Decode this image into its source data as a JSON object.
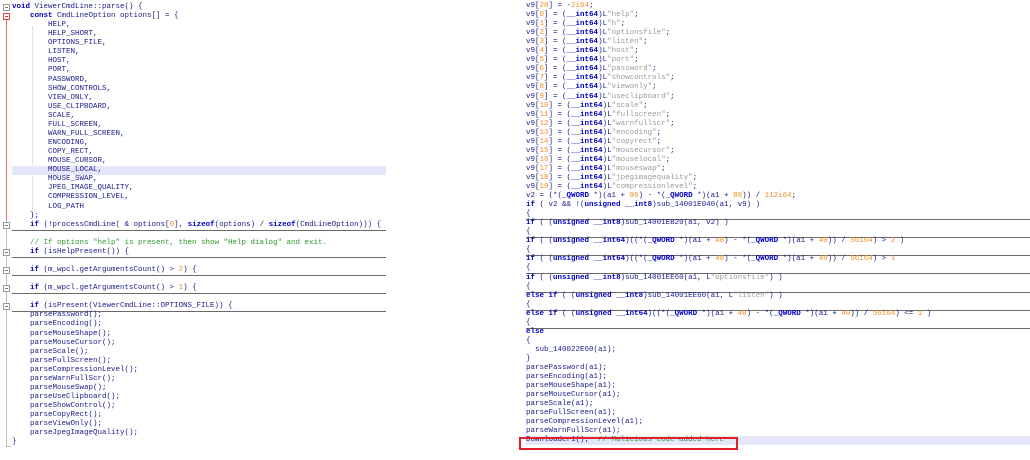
{
  "left_code": {
    "highlight_index": 18,
    "lines": [
      {
        "text": "void ViewerCmdLine::parse() {",
        "fold": "open"
      },
      {
        "text": "    const CmdLineOption options[] = {",
        "fold": "red"
      },
      {
        "text": "        HELP,"
      },
      {
        "text": "        HELP_SHORT,"
      },
      {
        "text": "        OPTIONS_FILE,"
      },
      {
        "text": "        LISTEN,"
      },
      {
        "text": "        HOST,"
      },
      {
        "text": "        PORT,"
      },
      {
        "text": "        PASSWORD,"
      },
      {
        "text": "        SHOW_CONTROLS,"
      },
      {
        "text": "        VIEW_ONLY,"
      },
      {
        "text": "        USE_CLIPBOARD,"
      },
      {
        "text": "        SCALE,"
      },
      {
        "text": "        FULL_SCREEN,"
      },
      {
        "text": "        WARN_FULL_SCREEN,"
      },
      {
        "text": "        ENCODING,"
      },
      {
        "text": "        COPY_RECT,"
      },
      {
        "text": "        MOUSE_CURSOR,"
      },
      {
        "text": "        MOUSE_LOCAL,"
      },
      {
        "text": "        MOUSE_SWAP,"
      },
      {
        "text": "        JPEG_IMAGE_QUALITY,"
      },
      {
        "text": "        COMPRESSION_LEVEL,"
      },
      {
        "text": "        LOG_PATH"
      },
      {
        "text": "    };"
      },
      {
        "text": "    if (!processCmdLine( & options[0], sizeof(options) / sizeof(CmdLineOption))) {",
        "fold": "closed",
        "collapsed": true
      },
      {
        "text": ""
      },
      {
        "text": "    // If options \"help\" is present, then show \"Help dialog\" and exit."
      },
      {
        "text": "    if (isHelpPresent()) {",
        "fold": "closed",
        "collapsed": true
      },
      {
        "text": ""
      },
      {
        "text": "    if (m_wpcl.getArgumentsCount() > 2) {",
        "fold": "closed",
        "collapsed": true
      },
      {
        "text": ""
      },
      {
        "text": "    if (m_wpcl.getArgumentsCount() > 1) {",
        "fold": "closed",
        "collapsed": true
      },
      {
        "text": ""
      },
      {
        "text": "    if (isPresent(ViewerCmdLine::OPTIONS_FILE)) {",
        "fold": "closed",
        "collapsed": true
      },
      {
        "text": "    parsePassword();"
      },
      {
        "text": "    parseEncoding();"
      },
      {
        "text": "    parseMouseShape();"
      },
      {
        "text": "    parseMouseCursor();"
      },
      {
        "text": "    parseScale();"
      },
      {
        "text": "    parseFullScreen();"
      },
      {
        "text": "    parseCompressionLevel();"
      },
      {
        "text": "    parseWarnFullScr();"
      },
      {
        "text": "    parseMouseSwap();"
      },
      {
        "text": "    parseUseClipboard();"
      },
      {
        "text": "    parseShowControl();"
      },
      {
        "text": "    parseCopyRect();"
      },
      {
        "text": "    parseViewOnly();"
      },
      {
        "text": "    parseJpegImageQuality();"
      },
      {
        "text": "}"
      }
    ]
  },
  "right_code": {
    "highlight_index": 48,
    "lines": [
      {
        "text": "v9[20] = -2i64;"
      },
      {
        "text": "v9[0] = (__int64)L\"help\";"
      },
      {
        "text": "v9[1] = (__int64)L\"h\";"
      },
      {
        "text": "v9[2] = (__int64)L\"optionsfile\";"
      },
      {
        "text": "v9[3] = (__int64)L\"listen\";"
      },
      {
        "text": "v9[4] = (__int64)L\"host\";"
      },
      {
        "text": "v9[5] = (__int64)L\"port\";"
      },
      {
        "text": "v9[6] = (__int64)L\"password\";"
      },
      {
        "text": "v9[7] = (__int64)L\"showcontrols\";"
      },
      {
        "text": "v9[8] = (__int64)L\"viewonly\";"
      },
      {
        "text": "v9[9] = (__int64)L\"useclipboard\";"
      },
      {
        "text": "v9[10] = (__int64)L\"scale\";"
      },
      {
        "text": "v9[11] = (__int64)L\"fullscreen\";"
      },
      {
        "text": "v9[12] = (__int64)L\"warnfullscr\";"
      },
      {
        "text": "v9[13] = (__int64)L\"encoding\";"
      },
      {
        "text": "v9[14] = (__int64)L\"copyrect\";"
      },
      {
        "text": "v9[15] = (__int64)L\"mousecursor\";"
      },
      {
        "text": "v9[16] = (__int64)L\"mouselocal\";"
      },
      {
        "text": "v9[17] = (__int64)L\"mouseswap\";"
      },
      {
        "text": "v9[18] = (__int64)L\"jpegimagequality\";"
      },
      {
        "text": "v9[19] = (__int64)L\"compressionlevel\";"
      },
      {
        "text": "v2 = (*(_QWORD *)(a1 + 96) - *(_QWORD *)(a1 + 88)) / 112i64;"
      },
      {
        "text": "if ( v2 && !(unsigned __int8)sub_14001E040(a1, v9) )"
      },
      {
        "text": "{",
        "collapsed": true
      },
      {
        "text": "if ( (unsigned __int8)sub_14001EB20(a1, v2) )"
      },
      {
        "text": "{",
        "collapsed": true
      },
      {
        "text": "if ( (unsigned __int64)((*(_QWORD *)(a1 + 48) - *(_QWORD *)(a1 + 40)) / 56i64) > 2 )"
      },
      {
        "text": "{",
        "collapsed": true
      },
      {
        "text": "if ( (unsigned __int64)((*(_QWORD *)(a1 + 48) - *(_QWORD *)(a1 + 40)) / 56i64) > 1"
      },
      {
        "text": "{",
        "collapsed": true
      },
      {
        "text": "if ( (unsigned __int8)sub_14001EE60(a1, L\"optionsfile\") )"
      },
      {
        "text": "{",
        "collapsed": true
      },
      {
        "text": "else if ( (unsigned __int8)sub_14001EE60(a1, L\"listen\") )"
      },
      {
        "text": "{",
        "collapsed": true
      },
      {
        "text": "else if ( (unsigned __int64)((*(_QWORD *)(a1 + 48) - *(_QWORD *)(a1 + 40)) / 56i64) <= 1 )"
      },
      {
        "text": "{",
        "collapsed": true
      },
      {
        "text": "else"
      },
      {
        "text": "{"
      },
      {
        "text": "  sub_140022E60(a1);"
      },
      {
        "text": "}"
      },
      {
        "text": "parsePassword(a1);"
      },
      {
        "text": "parseEncoding(a1);"
      },
      {
        "text": "parseMouseShape(a1);"
      },
      {
        "text": "parseMouseCursor(a1);"
      },
      {
        "text": "parseScale(a1);"
      },
      {
        "text": "parseFullScreen(a1);"
      },
      {
        "text": "parseCompressionLevel(a1);"
      },
      {
        "text": "parseWarnFullScr(a1);"
      },
      {
        "text": "Downloader1();  // Malicious code added here"
      }
    ]
  },
  "colors": {
    "keyword": "#0000c8",
    "number": "#f08c1e",
    "string": "#9a9a9a",
    "comment": "#2a9a2a",
    "highlight": "#e6e6fa",
    "annotation_box": "#e0202a"
  }
}
